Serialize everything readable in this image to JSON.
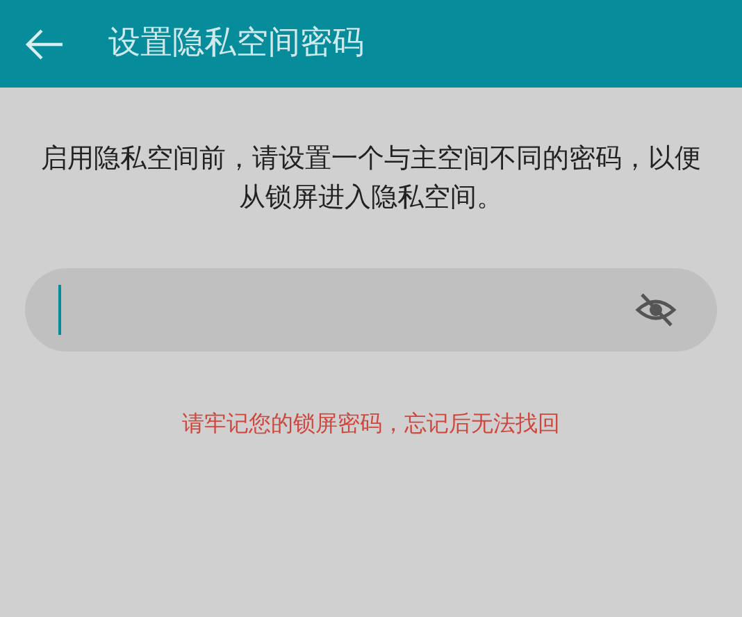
{
  "header": {
    "title": "设置隐私空间密码"
  },
  "description": "启用隐私空间前，请设置一个与主空间不同的密码，以便从锁屏进入隐私空间。",
  "password_field": {
    "visible": false
  },
  "warning": "请牢记您的锁屏密码，忘记后无法找回"
}
